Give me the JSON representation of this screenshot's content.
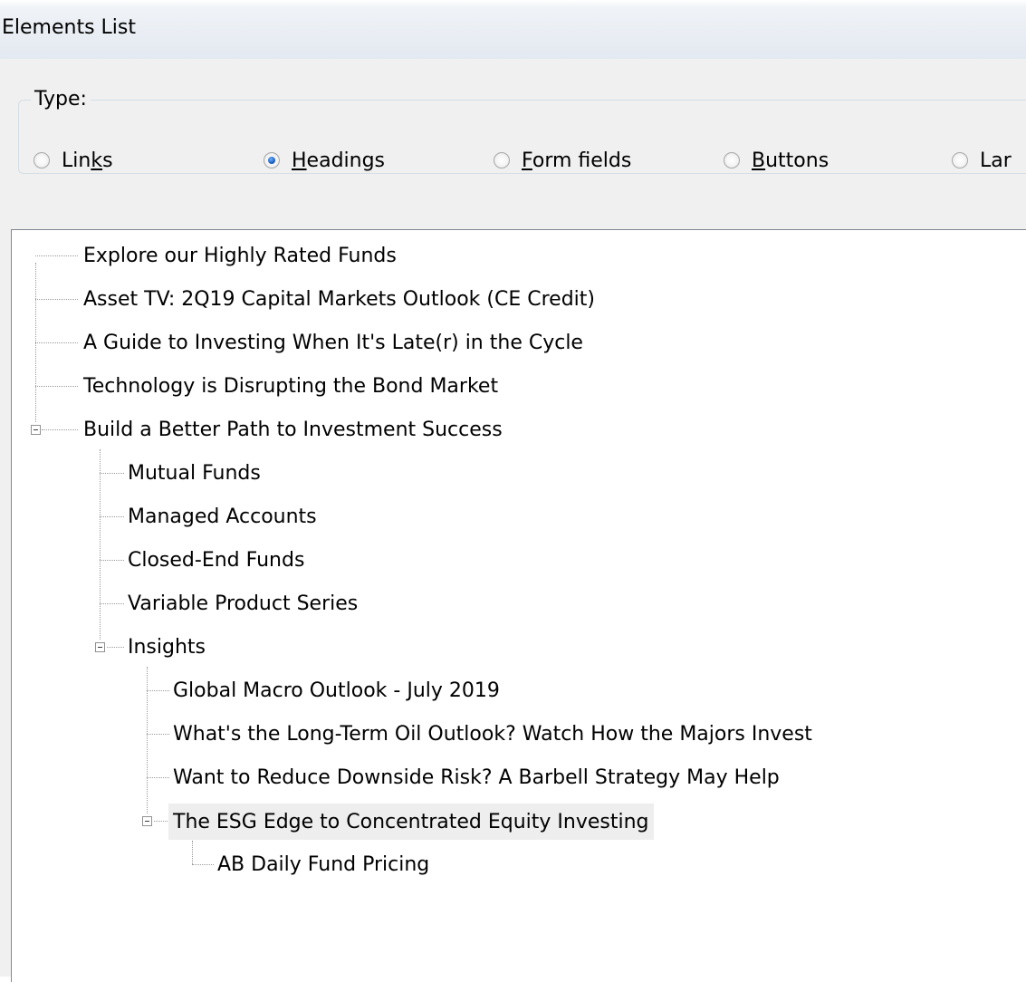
{
  "window": {
    "title": "Elements List"
  },
  "type_group": {
    "legend": "Type:",
    "options": [
      {
        "pre": "Lin",
        "mnemonic": "k",
        "post": "s",
        "checked": false
      },
      {
        "pre": "",
        "mnemonic": "H",
        "post": "eadings",
        "checked": true
      },
      {
        "pre": "",
        "mnemonic": "F",
        "post": "orm fields",
        "checked": false
      },
      {
        "pre": "",
        "mnemonic": "B",
        "post": "uttons",
        "checked": false
      },
      {
        "pre": "Lar",
        "mnemonic": "",
        "post": "",
        "checked": false
      }
    ]
  },
  "tree": {
    "selected": "The ESG Edge to Concentrated Equity Investing",
    "items": [
      "Explore our Highly Rated Funds",
      "Asset TV: 2Q19 Capital Markets Outlook (CE Credit)",
      "A Guide to Investing When It's Late(r) in the Cycle",
      "Technology is Disrupting the Bond Market",
      "Build a Better Path to Investment Success",
      "Mutual Funds",
      "Managed Accounts",
      "Closed-End Funds",
      "Variable Product Series",
      "Insights",
      "Global Macro Outlook - July 2019",
      "What's the Long-Term Oil Outlook? Watch How the Majors Invest",
      "Want to Reduce Downside Risk? A Barbell Strategy May Help",
      "The ESG Edge to Concentrated Equity Investing",
      "AB Daily Fund Pricing"
    ]
  }
}
